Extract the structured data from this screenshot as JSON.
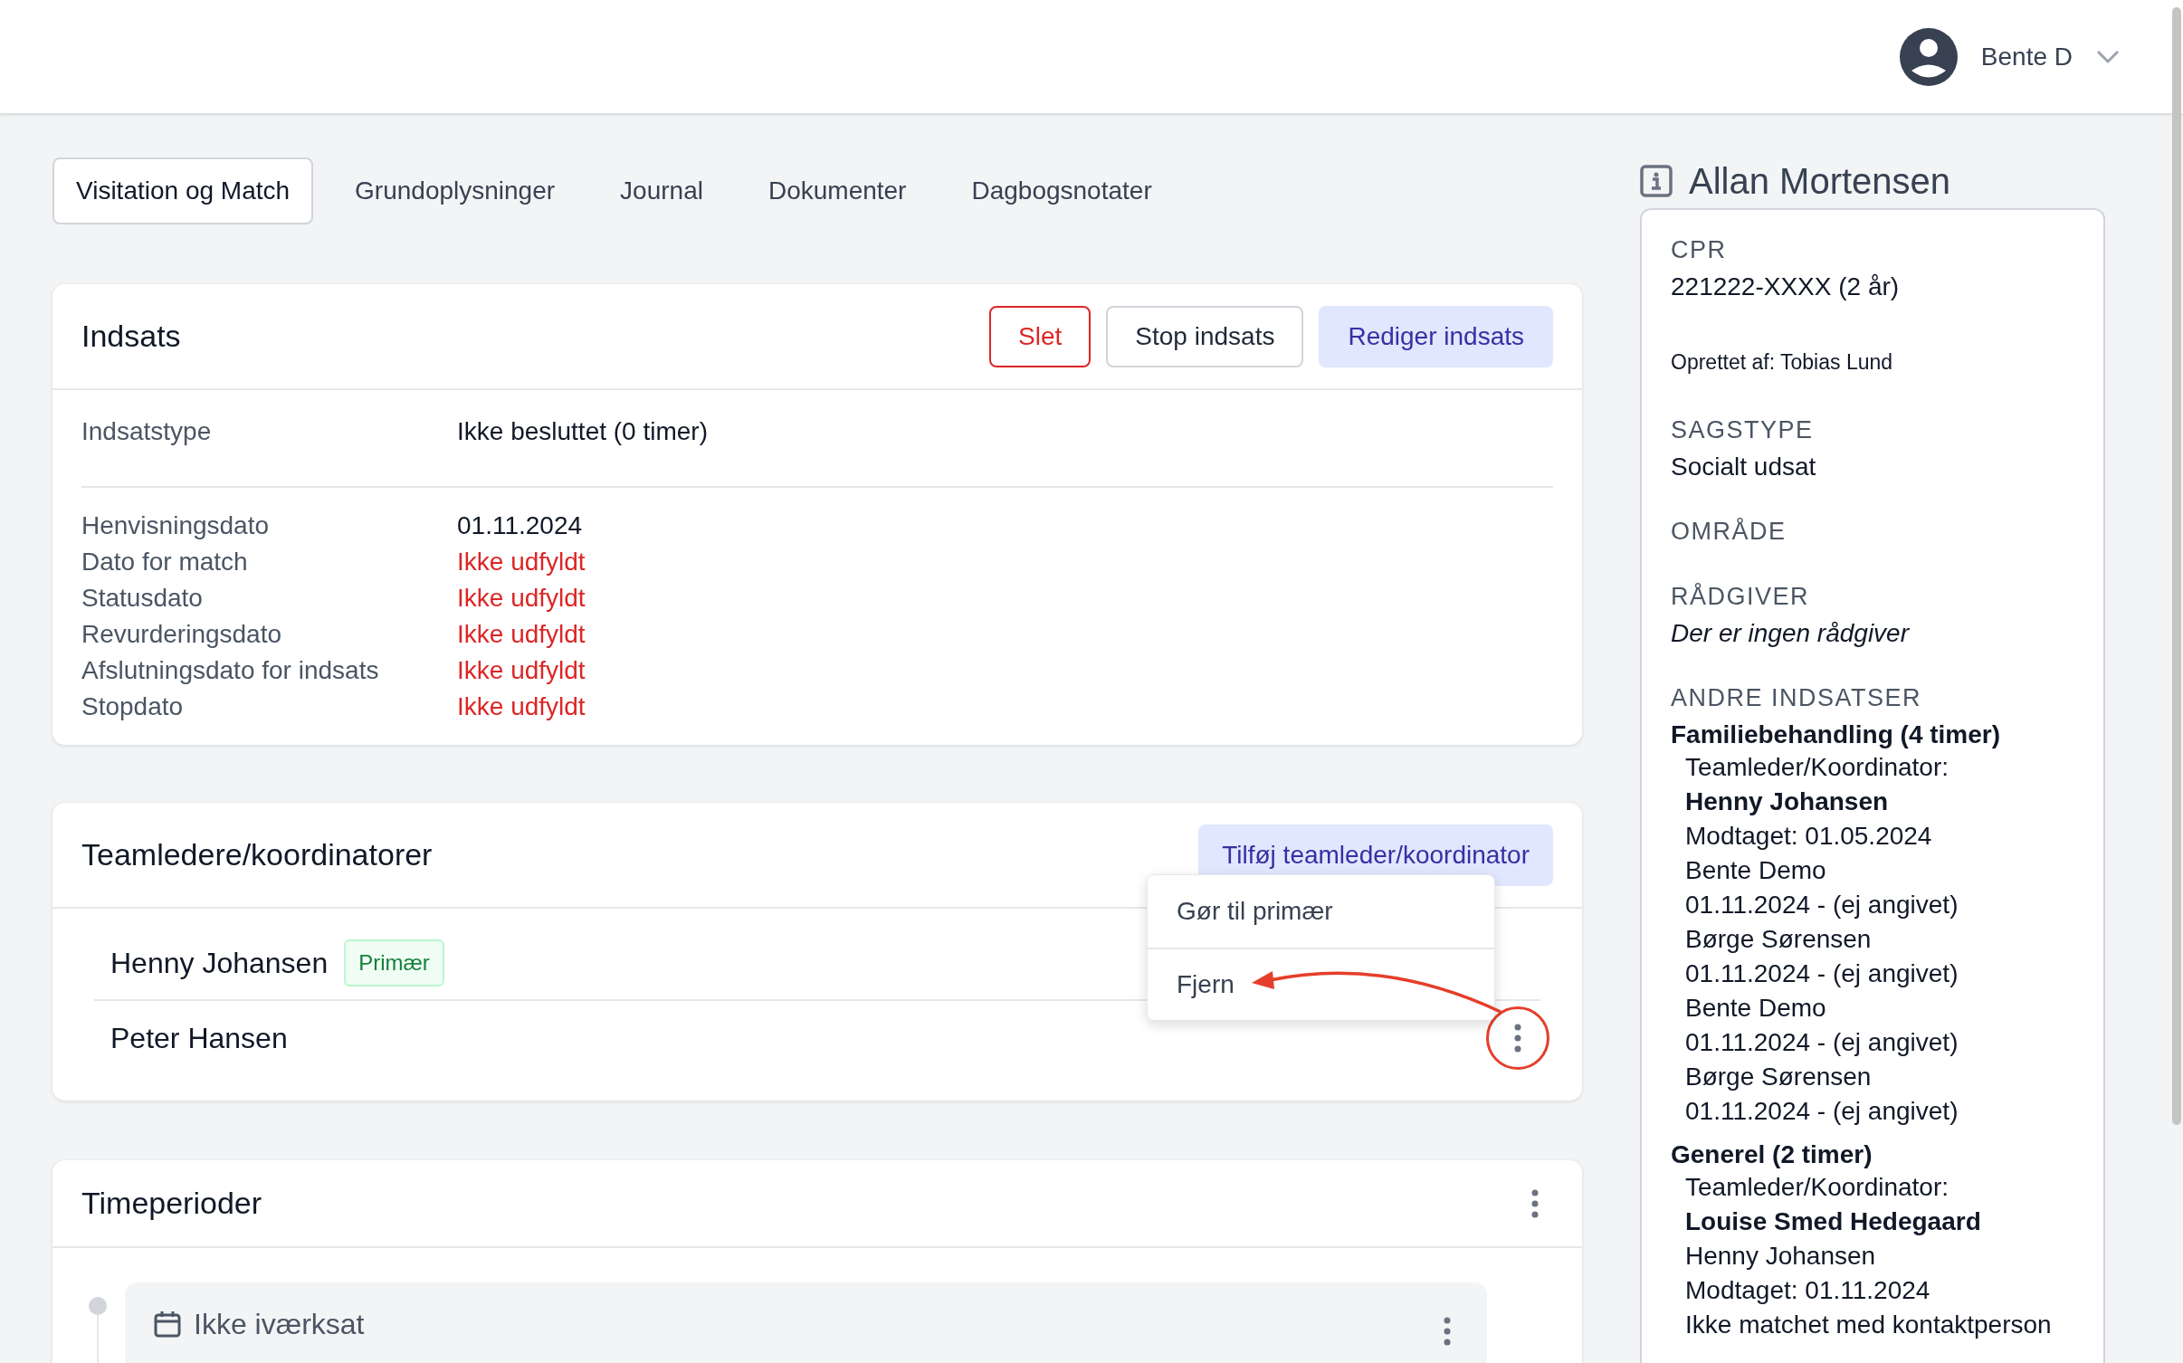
{
  "header": {
    "user_name": "Bente D"
  },
  "tabs": [
    {
      "label": "Visitation og Match",
      "selected": true
    },
    {
      "label": "Grundoplysninger",
      "selected": false
    },
    {
      "label": "Journal",
      "selected": false
    },
    {
      "label": "Dokumenter",
      "selected": false
    },
    {
      "label": "Dagbogsnotater",
      "selected": false
    }
  ],
  "indsats": {
    "title": "Indsats",
    "buttons": [
      {
        "label": "Slet",
        "kind": "danger"
      },
      {
        "label": "Stop indsats",
        "kind": "outline"
      },
      {
        "label": "Rediger indsats",
        "kind": "primary"
      }
    ],
    "type_row": {
      "label": "Indsatstype",
      "value": "Ikke besluttet (0 timer)"
    },
    "dates": [
      {
        "label": "Henvisningsdato",
        "value": "01.11.2024",
        "missing": false
      },
      {
        "label": "Dato for match",
        "value": "Ikke udfyldt",
        "missing": true
      },
      {
        "label": "Statusdato",
        "value": "Ikke udfyldt",
        "missing": true
      },
      {
        "label": "Revurderingsdato",
        "value": "Ikke udfyldt",
        "missing": true
      },
      {
        "label": "Afslutningsdato for indsats",
        "value": "Ikke udfyldt",
        "missing": true
      },
      {
        "label": "Stopdato",
        "value": "Ikke udfyldt",
        "missing": true
      }
    ]
  },
  "team": {
    "title": "Teamledere/koordinatorer",
    "add_button": "Tilføj teamleder/koordinator",
    "members": [
      {
        "name": "Henny Johansen",
        "badge": "Primær"
      },
      {
        "name": "Peter Hansen"
      }
    ],
    "menu": [
      "Gør til primær",
      "Fjern"
    ]
  },
  "timeperioder": {
    "title": "Timeperioder",
    "periods": [
      {
        "label": "Ikke iværksat"
      }
    ]
  },
  "sidebar": {
    "name": "Allan Mortensen",
    "cpr_label": "CPR",
    "cpr_value": "221222-XXXX (2 år)",
    "created_by": "Oprettet af: Tobias Lund",
    "fields": [
      {
        "label": "SAGSTYPE",
        "value": "Socialt udsat",
        "kind": "plain"
      },
      {
        "label": "OMRÅDE",
        "kind": "empty"
      },
      {
        "label": "RÅDGIVER",
        "value": "Der er ingen rådgiver",
        "kind": "italic"
      }
    ],
    "other_label": "ANDRE INDSATSER",
    "others": [
      {
        "title": "Familiebehandling (4 timer)",
        "lines": [
          {
            "text": "Teamleder/Koordinator:",
            "kind": "plain"
          },
          {
            "text": "Henny Johansen",
            "kind": "bold"
          },
          {
            "text": "Modtaget: 01.05.2024",
            "kind": "plain"
          },
          {
            "text": "Bente Demo",
            "kind": "plain"
          },
          {
            "text": "01.11.2024 - (ej angivet)",
            "kind": "plain"
          },
          {
            "text": "Børge Sørensen",
            "kind": "plain"
          },
          {
            "text": "01.11.2024 - (ej angivet)",
            "kind": "plain"
          },
          {
            "text": "Bente Demo",
            "kind": "plain"
          },
          {
            "text": "01.11.2024 - (ej angivet)",
            "kind": "plain"
          },
          {
            "text": "Børge Sørensen",
            "kind": "plain"
          },
          {
            "text": "01.11.2024 - (ej angivet)",
            "kind": "plain"
          }
        ]
      },
      {
        "title": "Generel (2 timer)",
        "lines": [
          {
            "text": "Teamleder/Koordinator:",
            "kind": "plain"
          },
          {
            "text": "Louise Smed Hedegaard",
            "kind": "bold"
          },
          {
            "text": "Henny Johansen",
            "kind": "plain"
          },
          {
            "text": "Modtaget: 01.11.2024",
            "kind": "plain"
          },
          {
            "text": "Ikke matchet med kontaktperson",
            "kind": "plain"
          }
        ]
      }
    ]
  }
}
